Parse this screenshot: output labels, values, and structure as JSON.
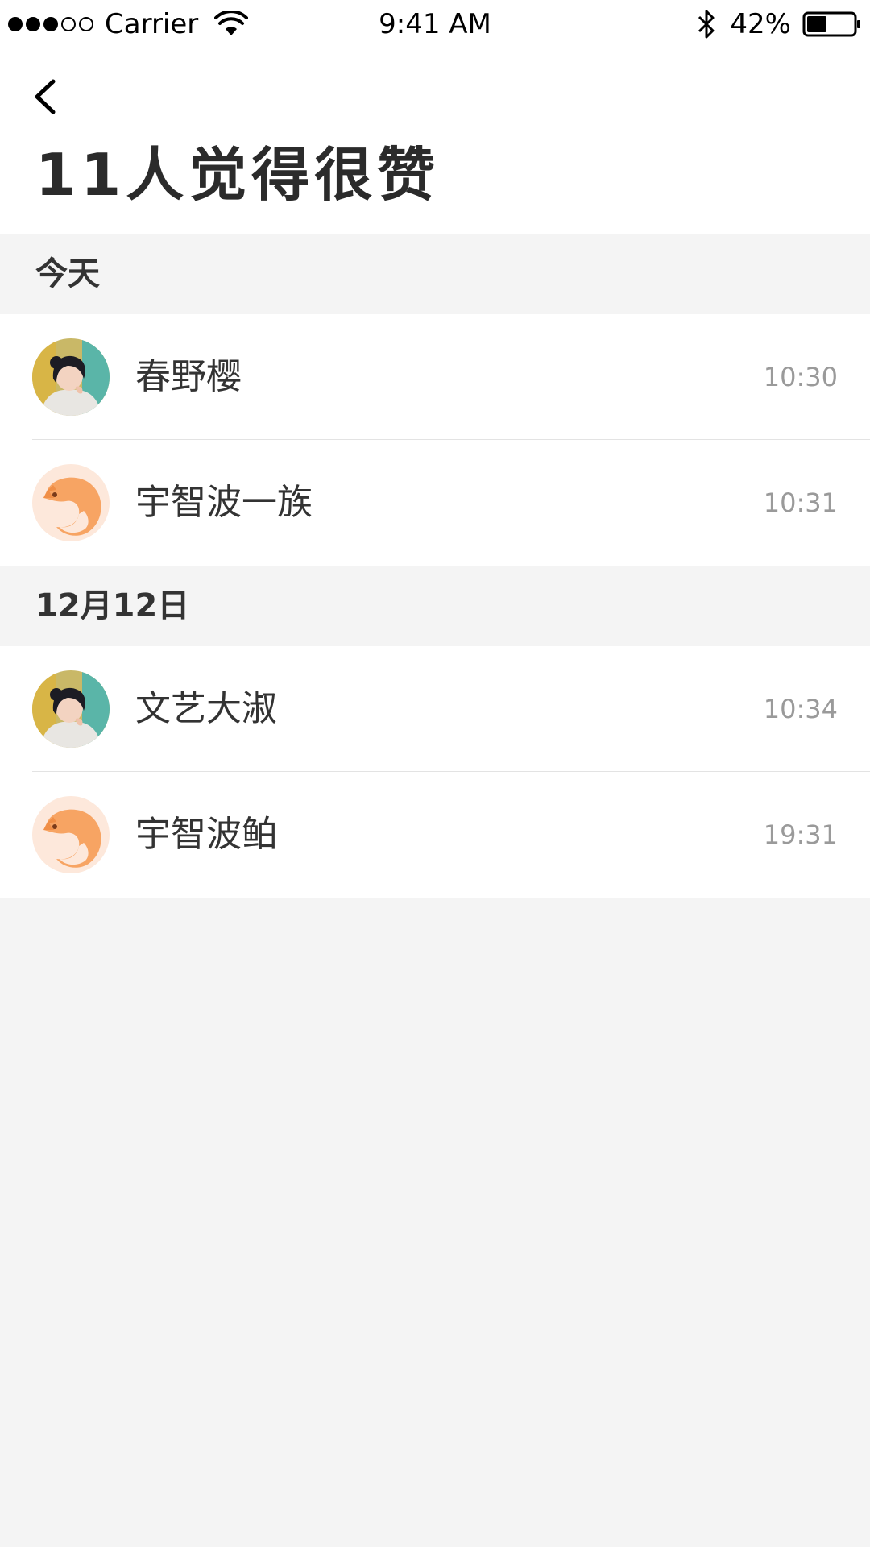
{
  "status_bar": {
    "carrier": "Carrier",
    "time": "9:41 AM",
    "battery_percent": "42%",
    "signal_bars_filled": 3,
    "signal_bars_total": 5,
    "battery_level": 0.42
  },
  "header": {
    "back_icon": "chevron-left-icon",
    "title": "11人觉得很赞"
  },
  "sections": [
    {
      "label": "今天",
      "items": [
        {
          "name": "春野樱",
          "time": "10:30",
          "avatar": "photo-avatar"
        },
        {
          "name": "宇智波一族",
          "time": "10:31",
          "avatar": "squirrel-avatar"
        }
      ]
    },
    {
      "label": "12月12日",
      "items": [
        {
          "name": "文艺大淑",
          "time": "10:34",
          "avatar": "photo-avatar"
        },
        {
          "name": "宇智波鲌",
          "time": "19:31",
          "avatar": "squirrel-avatar"
        }
      ]
    }
  ],
  "colors": {
    "background": "#f4f4f4",
    "surface": "#ffffff",
    "title_text": "#2b2b2b",
    "time_text": "#9a9a9a",
    "divider": "#e3e3e3",
    "squirrel_orange": "#f7a463"
  }
}
